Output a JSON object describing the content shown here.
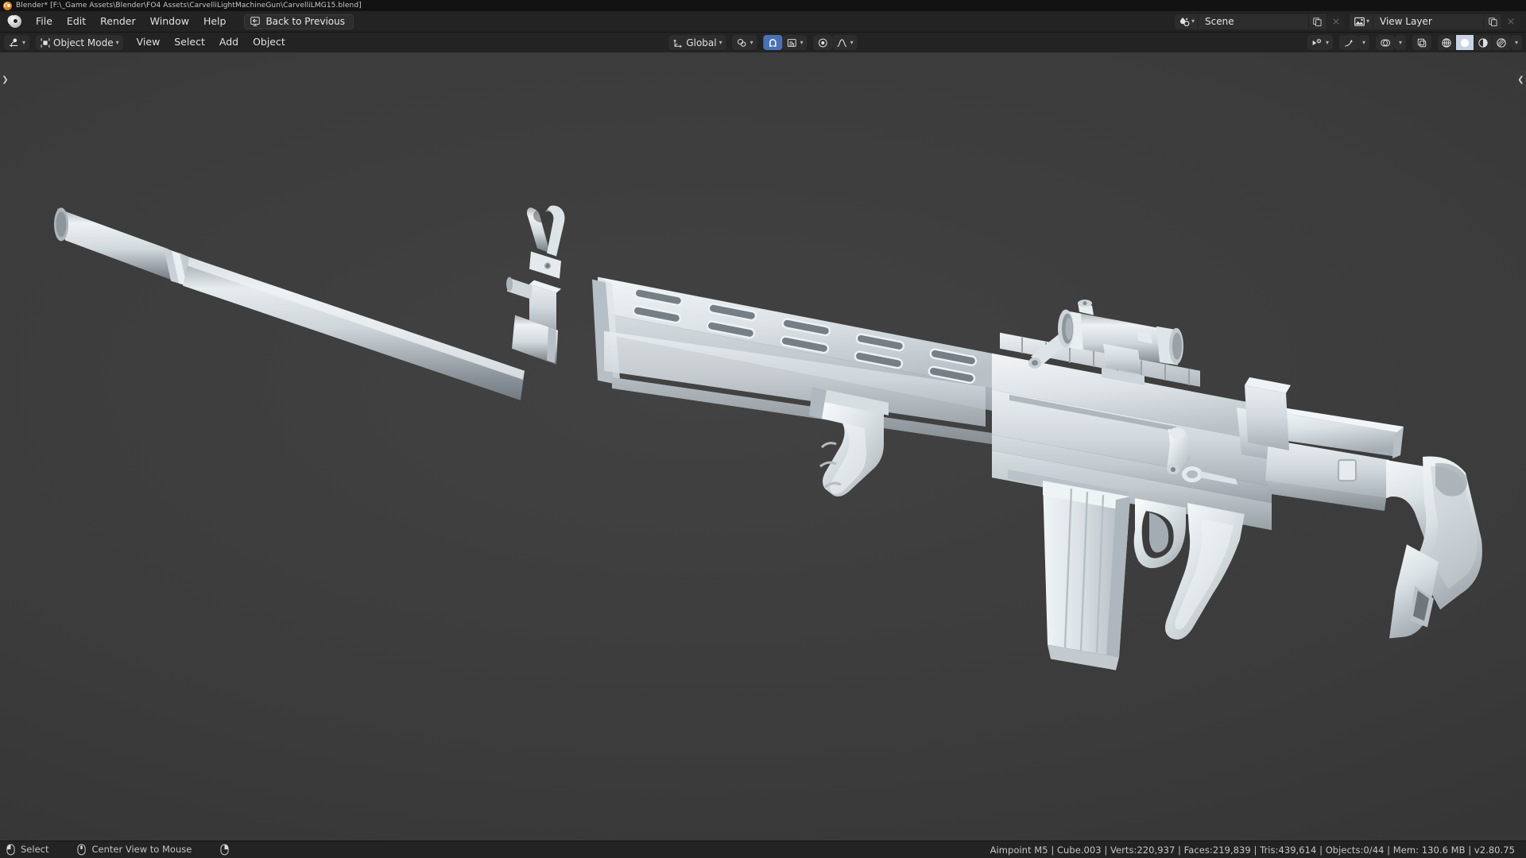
{
  "titlebar": {
    "logo_icon": "blender-logo-icon",
    "text": "Blender* [F:\\_Game Assets\\Blender\\FO4 Assets\\CarvelliLightMachineGun\\CarvelliLMG15.blend]"
  },
  "topbar": {
    "app_icon": "blender-logo-icon",
    "menus": [
      {
        "label": "File"
      },
      {
        "label": "Edit"
      },
      {
        "label": "Render"
      },
      {
        "label": "Window"
      },
      {
        "label": "Help"
      }
    ],
    "back_button": {
      "label": "Back to Previous",
      "icon": "back-arrow-icon"
    },
    "scene": {
      "browse_icon": "scene-data-icon",
      "value": "Scene",
      "new_icon": "duplicate-icon",
      "delete_icon": "close-x-icon"
    },
    "view_layer": {
      "browse_icon": "view-layer-icon",
      "value": "View Layer",
      "new_icon": "duplicate-icon",
      "delete_icon": "close-x-icon"
    }
  },
  "viewport_header": {
    "editor_type_icon": "editor-type-3dview-icon",
    "mode": {
      "icon": "object-mode-icon",
      "label": "Object Mode"
    },
    "menus": [
      {
        "label": "View"
      },
      {
        "label": "Select"
      },
      {
        "label": "Add"
      },
      {
        "label": "Object"
      }
    ],
    "transform_orientation": {
      "icon": "orientation-axes-icon",
      "label": "Global"
    },
    "pivot": {
      "icon": "pivot-point-icon"
    },
    "snap": {
      "magnet_icon": "magnet-icon",
      "active": true,
      "target_icon": "snap-increment-icon"
    },
    "proportional": {
      "toggle_icon": "proportional-editing-icon",
      "falloff_icon": "smooth-falloff-icon"
    },
    "right_tools": {
      "visibility_icon": "object-visibility-icon",
      "gizmo_icon": "gizmo-icon",
      "overlays_icon": "overlays-icon",
      "xray_icon": "xray-toggle-icon",
      "shading": [
        {
          "name": "wireframe-shading-icon",
          "active": false
        },
        {
          "name": "solid-shading-icon",
          "active": true
        },
        {
          "name": "material-preview-shading-icon",
          "active": false
        },
        {
          "name": "rendered-shading-icon",
          "active": false
        }
      ]
    }
  },
  "viewport": {
    "left_tab_icon": "sidebar-expand-right-icon",
    "right_tab_icon": "sidebar-expand-left-icon",
    "background_color": "#3b3b3b",
    "model_name": "Carvelli Light Machine Gun",
    "model_material_color": "#d5dadd"
  },
  "statusbar": {
    "keymap": [
      {
        "icon": "mouse-left-button-icon",
        "label": "Select"
      },
      {
        "icon": "mouse-middle-button-icon",
        "label": "Center View to Mouse"
      },
      {
        "icon": "mouse-right-button-icon",
        "label": ""
      }
    ],
    "stats": "Aimpoint M5 | Cube.003 | Verts:220,937 | Faces:219,839 | Tris:439,614 | Objects:0/44 | Mem: 130.6 MB | v2.80.75"
  }
}
